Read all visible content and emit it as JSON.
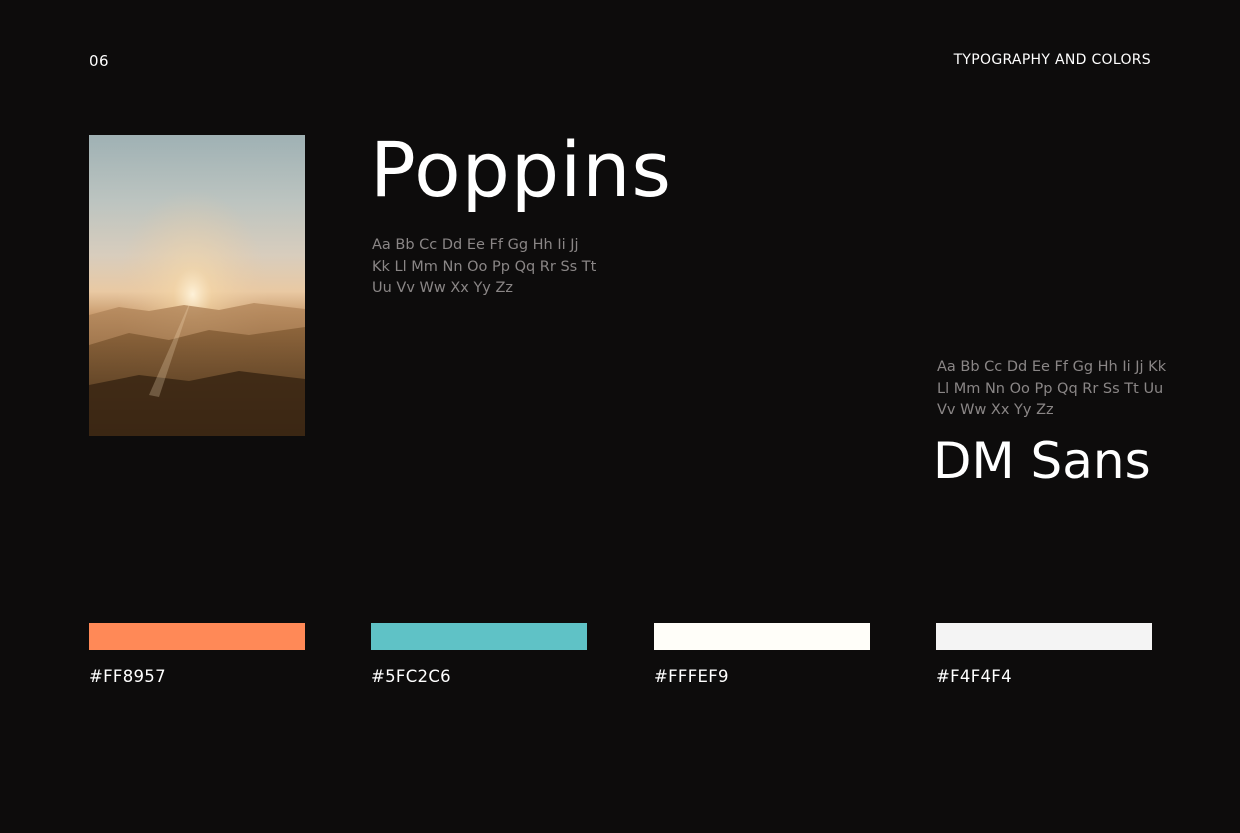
{
  "header": {
    "page_number": "06",
    "section_title": "TYPOGRAPHY AND COLORS"
  },
  "typography": {
    "primary": {
      "name": "Poppins",
      "glyph_lines": [
        "Aa Bb Cc Dd Ee Ff Gg Hh Ii Jj",
        "Kk Ll Mm Nn Oo Pp Qq Rr Ss Tt",
        "Uu Vv Ww Xx Yy Zz"
      ]
    },
    "secondary": {
      "name": "DM Sans",
      "glyph_lines": [
        "Aa Bb Cc Dd Ee Ff Gg Hh Ii Jj Kk",
        "Ll Mm Nn Oo Pp Qq Rr Ss Tt Uu",
        "Vv Ww Xx Yy Zz"
      ]
    }
  },
  "colors": [
    {
      "hex": "#FF8957",
      "label": "#FF8957"
    },
    {
      "hex": "#5FC2C6",
      "label": "#5FC2C6"
    },
    {
      "hex": "#FFFEF9",
      "label": "#FFFEF9"
    },
    {
      "hex": "#F4F4F4",
      "label": "#F4F4F4"
    }
  ]
}
